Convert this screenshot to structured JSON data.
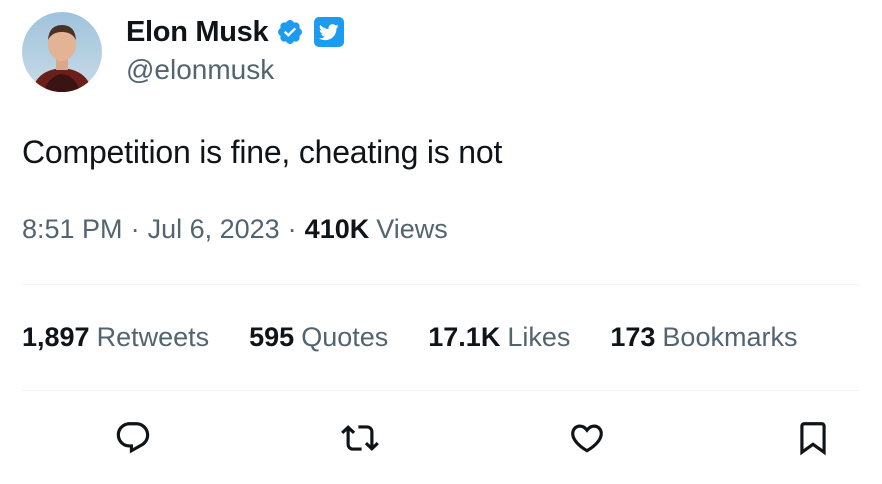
{
  "author": {
    "display_name": "Elon Musk",
    "handle": "@elonmusk",
    "verified_icon": "verified-badge-icon",
    "platform_icon": "twitter-bird-icon"
  },
  "tweet": {
    "text": "Competition is fine, cheating is not",
    "time": "8:51 PM",
    "separator": "·",
    "date": "Jul 6, 2023",
    "views_count": "410K",
    "views_label": "Views"
  },
  "stats": [
    {
      "count": "1,897",
      "label": "Retweets"
    },
    {
      "count": "595",
      "label": "Quotes"
    },
    {
      "count": "17.1K",
      "label": "Likes"
    },
    {
      "count": "173",
      "label": "Bookmarks"
    }
  ],
  "actions": [
    "reply-icon",
    "retweet-icon",
    "like-icon",
    "bookmark-icon"
  ],
  "colors": {
    "accent": "#1d9bf0",
    "text_primary": "#0f1419",
    "text_secondary": "#536471",
    "divider": "#eff3f4"
  }
}
